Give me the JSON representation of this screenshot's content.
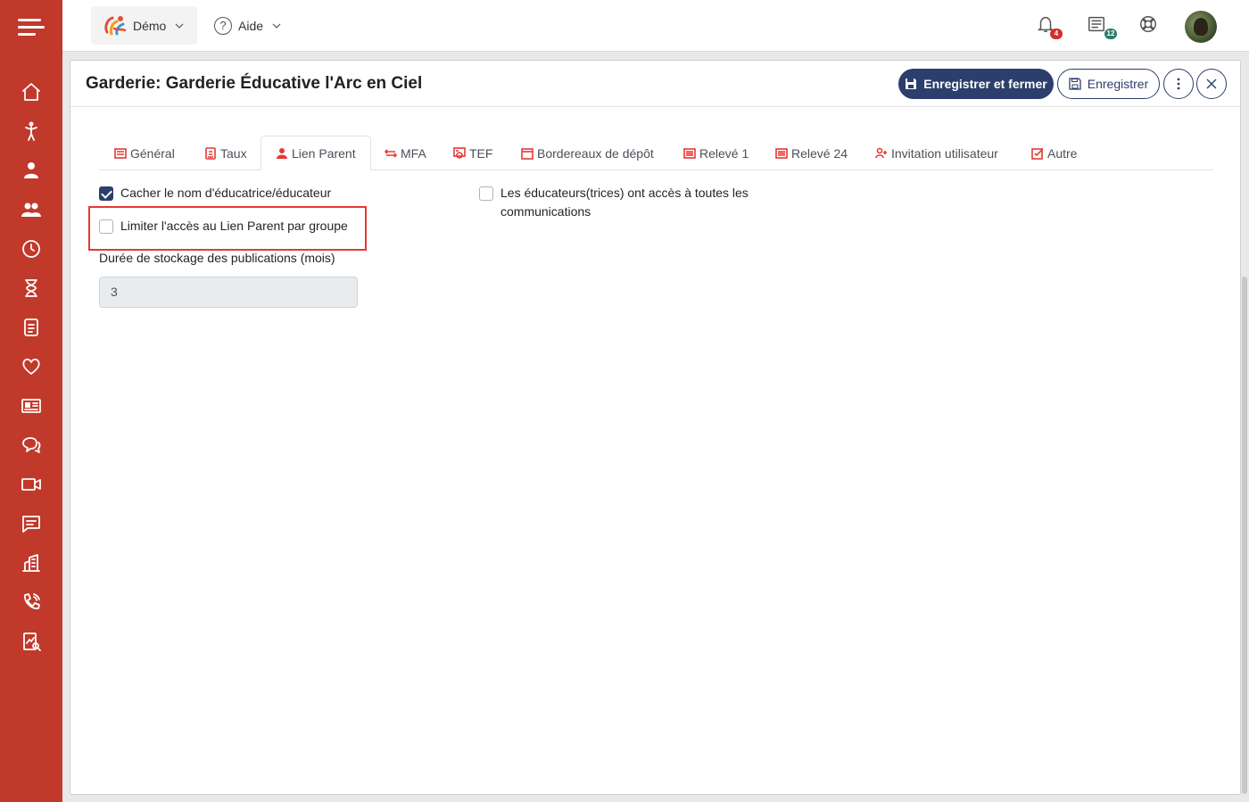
{
  "topbar": {
    "org_label": "Démo",
    "help_label": "Aide",
    "notifications_badge": "4",
    "news_badge": "12",
    "notif_badge_color": "#d32f2f",
    "news_badge_color": "#2e7d6e"
  },
  "sidebar": {
    "items": [
      "home-icon",
      "child-icon",
      "parent-icon",
      "users-icon",
      "clock-icon",
      "hourglass-icon",
      "invoice-icon",
      "heart-icon",
      "id-card-icon",
      "chat-icon",
      "video-icon",
      "message-icon",
      "building-icon",
      "phone-icon",
      "report-icon"
    ]
  },
  "modal": {
    "title": "Garderie: Garderie Éducative l'Arc en Ciel",
    "save_close_label": "Enregistrer et fermer",
    "save_label": "Enregistrer"
  },
  "tabs": [
    {
      "label": "Général",
      "icon": "list-icon"
    },
    {
      "label": "Taux",
      "icon": "rate-icon"
    },
    {
      "label": "Lien Parent",
      "icon": "parent-link-icon",
      "active": true
    },
    {
      "label": "MFA",
      "icon": "arrows-icon"
    },
    {
      "label": "TEF",
      "icon": "tef-icon"
    },
    {
      "label": "Bordereaux de dépôt",
      "icon": "calendar-icon"
    },
    {
      "label": "Relevé 1",
      "icon": "doc-icon"
    },
    {
      "label": "Relevé 24",
      "icon": "doc-icon"
    },
    {
      "label": "Invitation utilisateur",
      "icon": "user-plus-icon"
    },
    {
      "label": "Autre",
      "icon": "check-square-icon"
    }
  ],
  "form": {
    "hide_educator_name": {
      "label": "Cacher le nom d'éducatrice/éducateur",
      "checked": true
    },
    "limit_access_by_group": {
      "label": "Limiter l'accès au Lien Parent par groupe",
      "checked": false
    },
    "educators_access_all": {
      "label": "Les éducateurs(trices) ont accès à toutes les communications",
      "checked": false
    },
    "storage_duration_label": "Durée de stockage des publications (mois)",
    "storage_duration_value": "3"
  },
  "colors": {
    "sidebar": "#c0392b",
    "primary": "#2c3e6b",
    "accent": "#e53935"
  }
}
